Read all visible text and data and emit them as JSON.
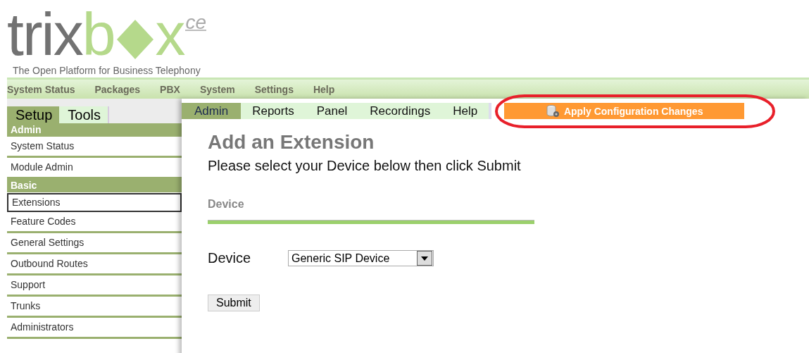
{
  "logo": {
    "part_1": "trix",
    "part_2": "b",
    "part_3": "x",
    "edition": "ce",
    "tagline": "The Open Platform for Business Telephony"
  },
  "main_nav": [
    "System Status",
    "Packages",
    "PBX",
    "System",
    "Settings",
    "Help"
  ],
  "sub_tabs": [
    {
      "label": "Admin",
      "selected": true
    },
    {
      "label": "Reports",
      "selected": false
    },
    {
      "label": "Panel",
      "selected": false
    },
    {
      "label": "Recordings",
      "selected": false
    },
    {
      "label": "Help",
      "selected": false
    }
  ],
  "apply_button": {
    "label": "Apply Configuration Changes"
  },
  "sidebar": {
    "tabs": [
      {
        "label": "Setup",
        "selected": true
      },
      {
        "label": "Tools",
        "selected": false
      }
    ],
    "items": [
      {
        "kind": "header",
        "label": "Admin",
        "selected": false
      },
      {
        "kind": "item",
        "label": "System Status",
        "selected": false
      },
      {
        "kind": "item",
        "label": "Module Admin",
        "selected": false
      },
      {
        "kind": "header",
        "label": "Basic",
        "selected": false
      },
      {
        "kind": "item",
        "label": "Extensions",
        "selected": true
      },
      {
        "kind": "item",
        "label": "Feature Codes",
        "selected": false
      },
      {
        "kind": "item",
        "label": "General Settings",
        "selected": false
      },
      {
        "kind": "item",
        "label": "Outbound Routes",
        "selected": false
      },
      {
        "kind": "item",
        "label": "Support",
        "selected": false
      },
      {
        "kind": "item",
        "label": "Trunks",
        "selected": false
      },
      {
        "kind": "item",
        "label": "Administrators",
        "selected": false
      }
    ]
  },
  "content": {
    "title": "Add an Extension",
    "instructions": "Please select your Device below then click Submit",
    "section": "Device",
    "device_label": "Device",
    "device_value": "Generic SIP Device",
    "submit": "Submit"
  }
}
